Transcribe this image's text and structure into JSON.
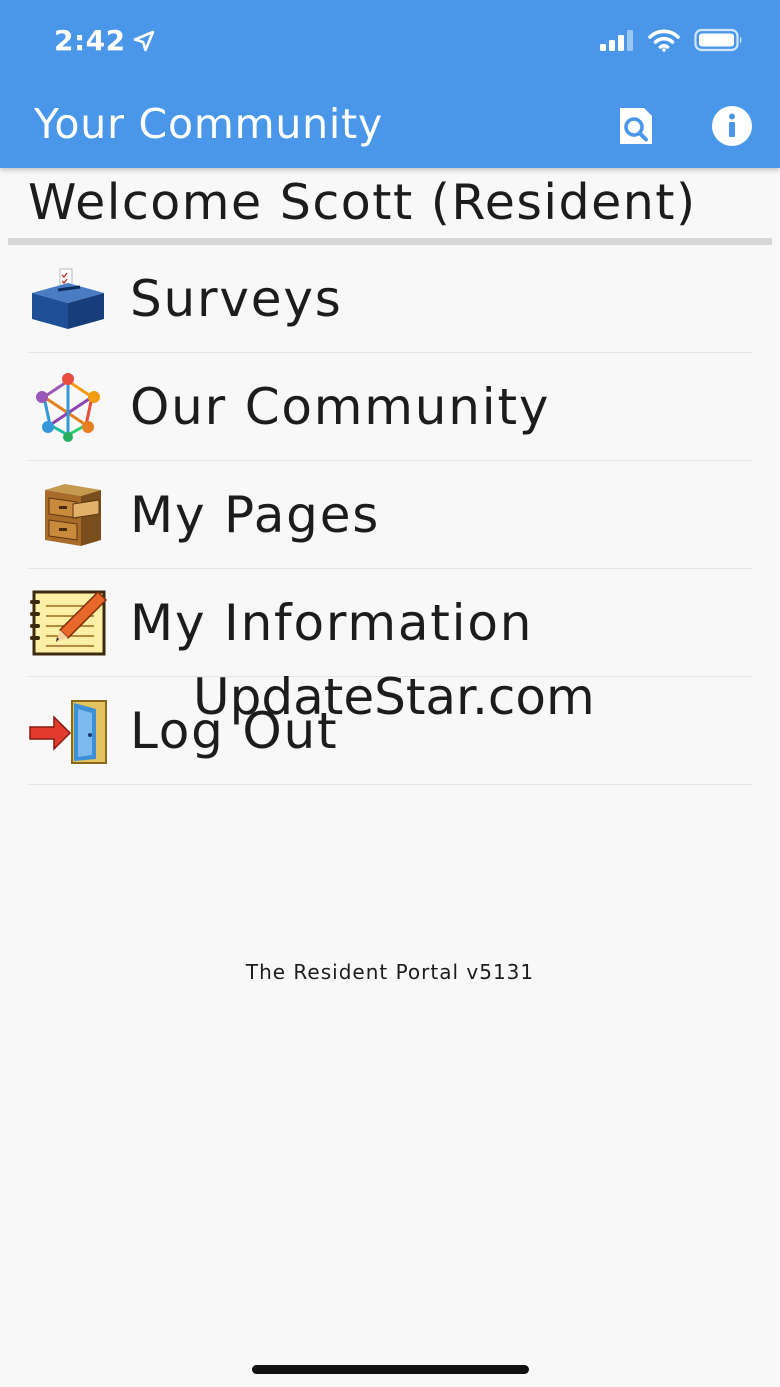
{
  "status_bar": {
    "time": "2:42",
    "icons": [
      "location-arrow-icon",
      "signal-icon",
      "wifi-icon",
      "battery-icon"
    ]
  },
  "app_bar": {
    "title": "Your Community",
    "actions": [
      "search-document-icon",
      "info-icon"
    ]
  },
  "welcome_text": "Welcome Scott (Resident)",
  "menu": {
    "items": [
      {
        "label": "Surveys",
        "icon": "ballot-box-icon"
      },
      {
        "label": "Our Community",
        "icon": "people-network-icon"
      },
      {
        "label": "My Pages",
        "icon": "file-cabinet-icon"
      },
      {
        "label": "My Information",
        "icon": "notepad-pencil-icon"
      },
      {
        "label": "Log Out",
        "icon": "exit-door-icon"
      }
    ]
  },
  "watermark": "UpdateStar.com",
  "footer": {
    "version": "The Resident Portal v5131"
  },
  "colors": {
    "header": "#4a97e9",
    "background": "#f8f8f8",
    "text": "#1c1c1c"
  }
}
